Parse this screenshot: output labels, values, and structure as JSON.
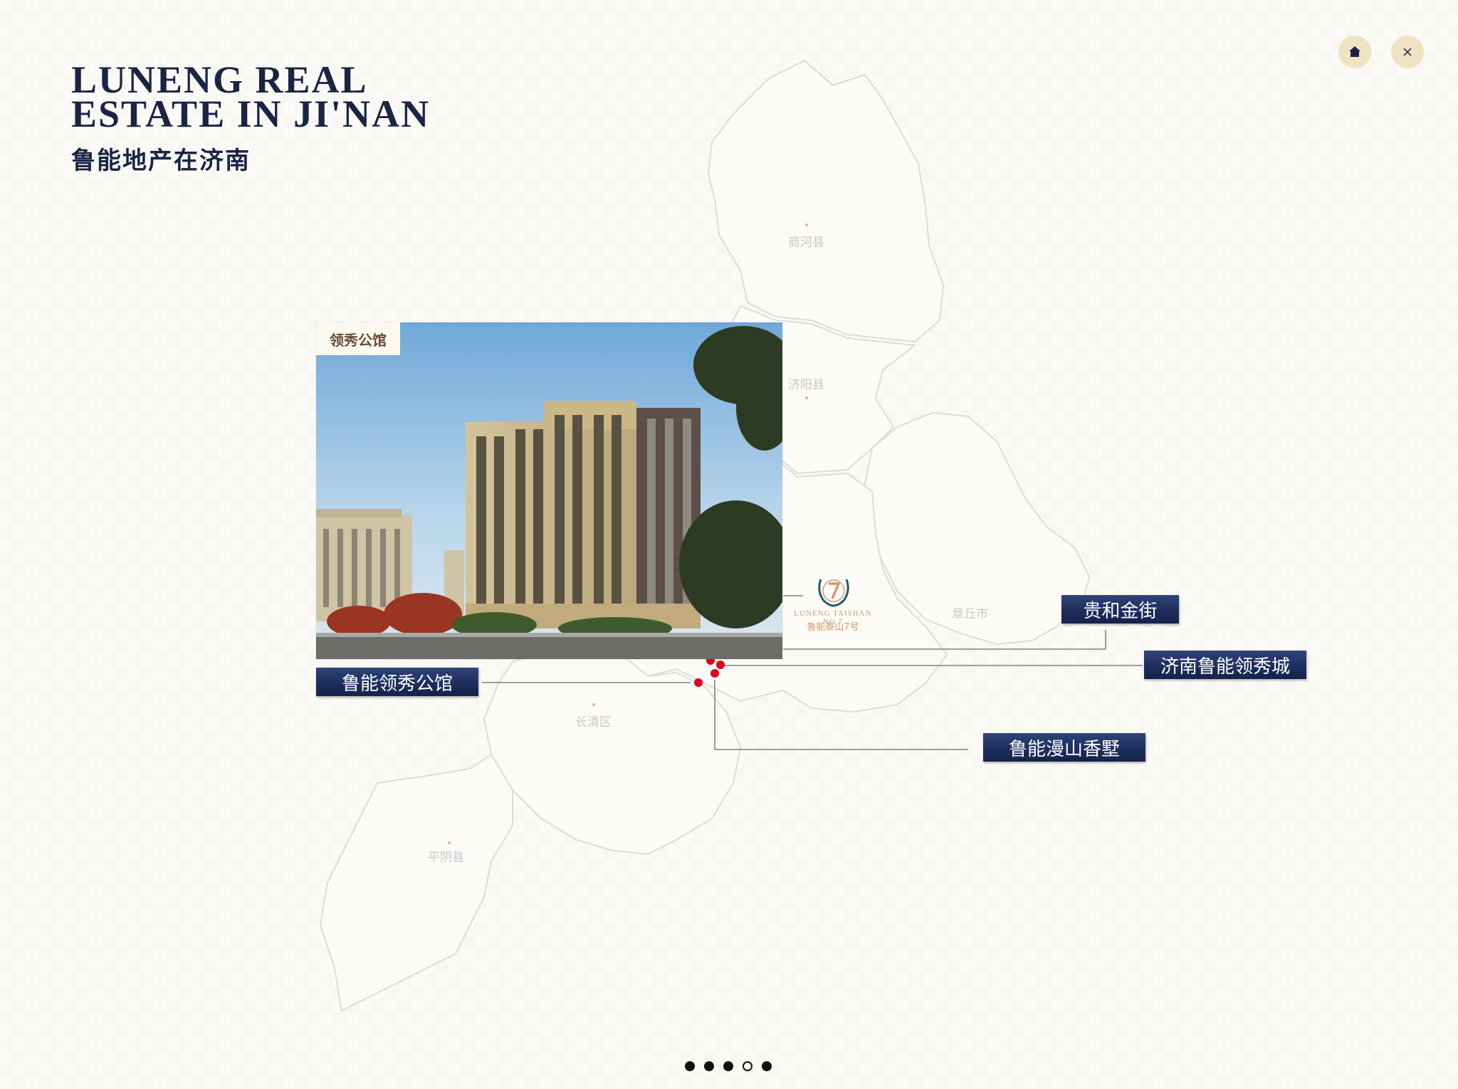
{
  "header": {
    "title_en": "LUNENG REAL ESTATE IN JI'NAN",
    "title_zh": "鲁能地产在济南"
  },
  "controls": {
    "home_icon": "home-icon",
    "close_icon": "close-icon"
  },
  "map": {
    "districts": [
      {
        "name": "商河县"
      },
      {
        "name": "济阳县"
      },
      {
        "name": "章丘市"
      },
      {
        "name": "长清区"
      },
      {
        "name": "平阴县"
      }
    ],
    "marker_color": "#e0001b"
  },
  "photo": {
    "logo_text": "领秀公馆"
  },
  "project_logo": {
    "text_en": "LUNENG TAISHAN NO.7",
    "text_zh": "鲁能泰山7号"
  },
  "callouts": {
    "lingxiu_gongguan": "鲁能领秀公馆",
    "guihe_jinjie": "贵和金街",
    "jinan_lingxiu_cheng": "济南鲁能领秀城",
    "manshan_xiangshu": "鲁能漫山香墅"
  },
  "pager": {
    "total": 5,
    "current": 4
  }
}
